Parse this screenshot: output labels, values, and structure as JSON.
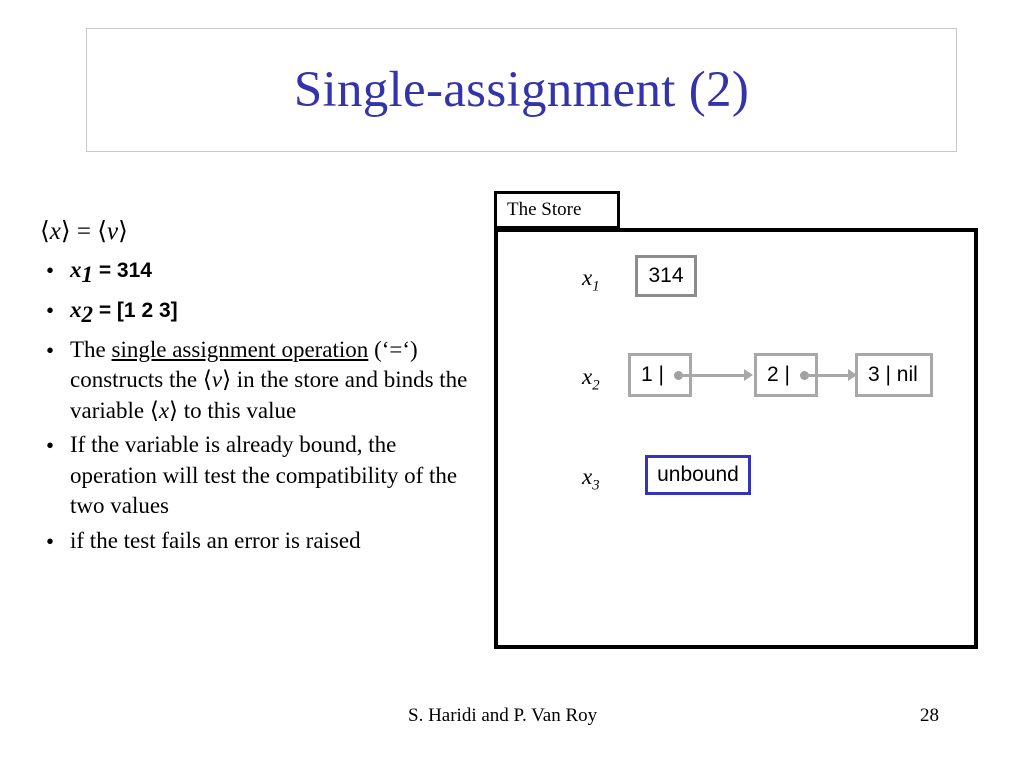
{
  "slide": {
    "title": "Single-assignment (2)",
    "title_color": "#3333ab",
    "page_number": "28",
    "footer_author": "S. Haridi and P. Van Roy"
  },
  "content": {
    "equation_line": {
      "left": "x",
      "operator": "=",
      "right": "v",
      "full": "⟨x⟩ = ⟨v⟩"
    },
    "bullets": [
      {
        "marker": "•",
        "style": "bold-sans",
        "var": "x",
        "subscript": "1",
        "rest": " = 314",
        "text": "x1 = 314"
      },
      {
        "marker": "•",
        "style": "bold-sans",
        "var": "x",
        "subscript": "2",
        "rest": " = [1 2 3]",
        "text": "x2 = [1 2 3]"
      },
      {
        "marker": "•",
        "style": "serif",
        "segments": [
          {
            "kind": "plain",
            "text": "The "
          },
          {
            "kind": "underline",
            "text": "single assignment operation"
          },
          {
            "kind": "plain",
            "text": " (‘=‘) constructs the "
          },
          {
            "kind": "angle-italic",
            "text": "v"
          },
          {
            "kind": "plain",
            "text": " in the store and binds the variable "
          },
          {
            "kind": "angle-italic",
            "text": "x"
          },
          {
            "kind": "plain",
            "text": " to this value"
          }
        ],
        "text": "The single assignment operation ('=') constructs the ⟨v⟩ in the store and binds the variable ⟨x⟩ to this value"
      },
      {
        "marker": "•",
        "style": "serif",
        "text": "If the variable is already bound, the operation will test the compatibility of the two values"
      },
      {
        "marker": "•",
        "style": "serif",
        "text": "if the test  fails an error is raised"
      }
    ]
  },
  "store": {
    "label": "The Store",
    "border_color": "#000000",
    "entries": [
      {
        "var": "x",
        "subscript": "1",
        "kind": "value-box",
        "value": "314",
        "border_color": "#8c8c8c"
      },
      {
        "var": "x",
        "subscript": "2",
        "kind": "cons-list",
        "cells": [
          {
            "head": "1",
            "tail": "pointer",
            "label": "1 |"
          },
          {
            "head": "2",
            "tail": "pointer",
            "label": "2 |"
          },
          {
            "head": "3",
            "tail": "nil",
            "label": "3 | nil"
          }
        ],
        "border_color": "#a8a8a8",
        "arrow_color": "#a8a8a8"
      },
      {
        "var": "x",
        "subscript": "3",
        "kind": "value-box",
        "value": "unbound",
        "border_color": "#3333bb"
      }
    ]
  }
}
